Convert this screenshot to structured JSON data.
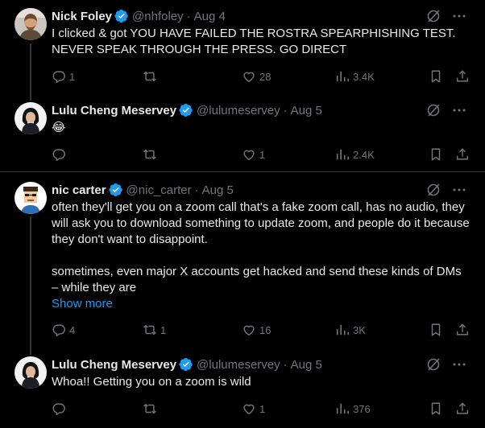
{
  "tweets": [
    {
      "name": "Nick Foley",
      "handle": "@nhfoley",
      "separator": "·",
      "date": "Aug 4",
      "text": "I clicked & got YOU HAVE FAILED THE ROSTRA SPEARPHISHING TEST.\nNEVER SPEAK THROUGH THE PRESS. GO DIRECT",
      "replies": "1",
      "retweets": "",
      "likes": "28",
      "views": "3.4K"
    },
    {
      "name": "Lulu Cheng Meservey",
      "handle": "@lulumeservey",
      "separator": "·",
      "date": "Aug 5",
      "text": "😂",
      "replies": "",
      "retweets": "",
      "likes": "1",
      "views": "2.4K"
    },
    {
      "name": "nic carter",
      "handle": "@nic_carter",
      "separator": "·",
      "date": "Aug 5",
      "text": "often they'll get you on a zoom call that's a fake zoom call, has no audio, they will ask you to download something to update zoom, and people do it because they don't want to disappoint.\n\nsometimes, even major X accounts get hacked and send these kinds of DMs – while they are",
      "show_more": "Show more",
      "replies": "4",
      "retweets": "1",
      "likes": "16",
      "views": "3K"
    },
    {
      "name": "Lulu Cheng Meservey",
      "handle": "@lulumeservey",
      "separator": "·",
      "date": "Aug 5",
      "text": "Whoa!! Getting you on a zoom is wild",
      "replies": "",
      "retweets": "",
      "likes": "1",
      "views": "376"
    }
  ],
  "icons": {
    "verified": "verified-badge-icon",
    "grok": "grok-icon",
    "more": "more-icon",
    "reply": "reply-icon",
    "retweet": "retweet-icon",
    "like": "heart-icon",
    "views": "views-icon",
    "bookmark": "bookmark-icon",
    "share": "share-icon"
  },
  "colors": {
    "background": "#000000",
    "text": "#e7e9ea",
    "muted": "#71767b",
    "accent": "#1d9bf0",
    "divider": "#2f3336"
  }
}
